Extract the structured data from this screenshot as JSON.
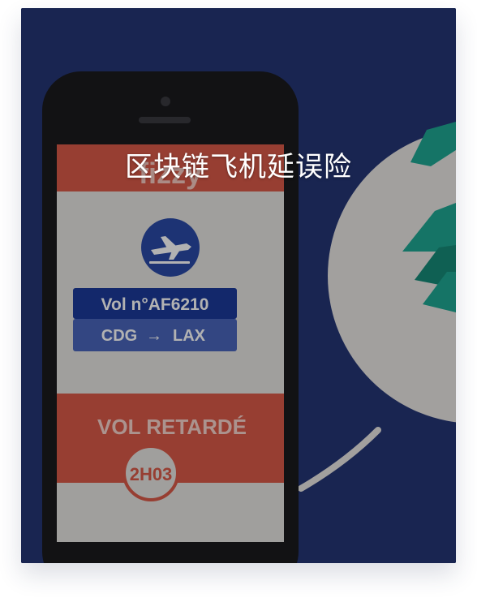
{
  "card": {
    "title": "区块链飞机延误险",
    "app_brand": "fizzy",
    "flight_number": "Vol n°AF6210",
    "route_from": "CDG",
    "route_arrow": "→",
    "route_to": "LAX",
    "delay_status": "VOL RETARDÉ",
    "delay_duration": "2H03"
  },
  "colors": {
    "background": "#243574",
    "phone_body": "#1a1a1e",
    "screen": "#e6e4e1",
    "banner_red": "#d85a48",
    "flight_blue": "#2a4aa6",
    "accent_green": "#1fa792"
  }
}
